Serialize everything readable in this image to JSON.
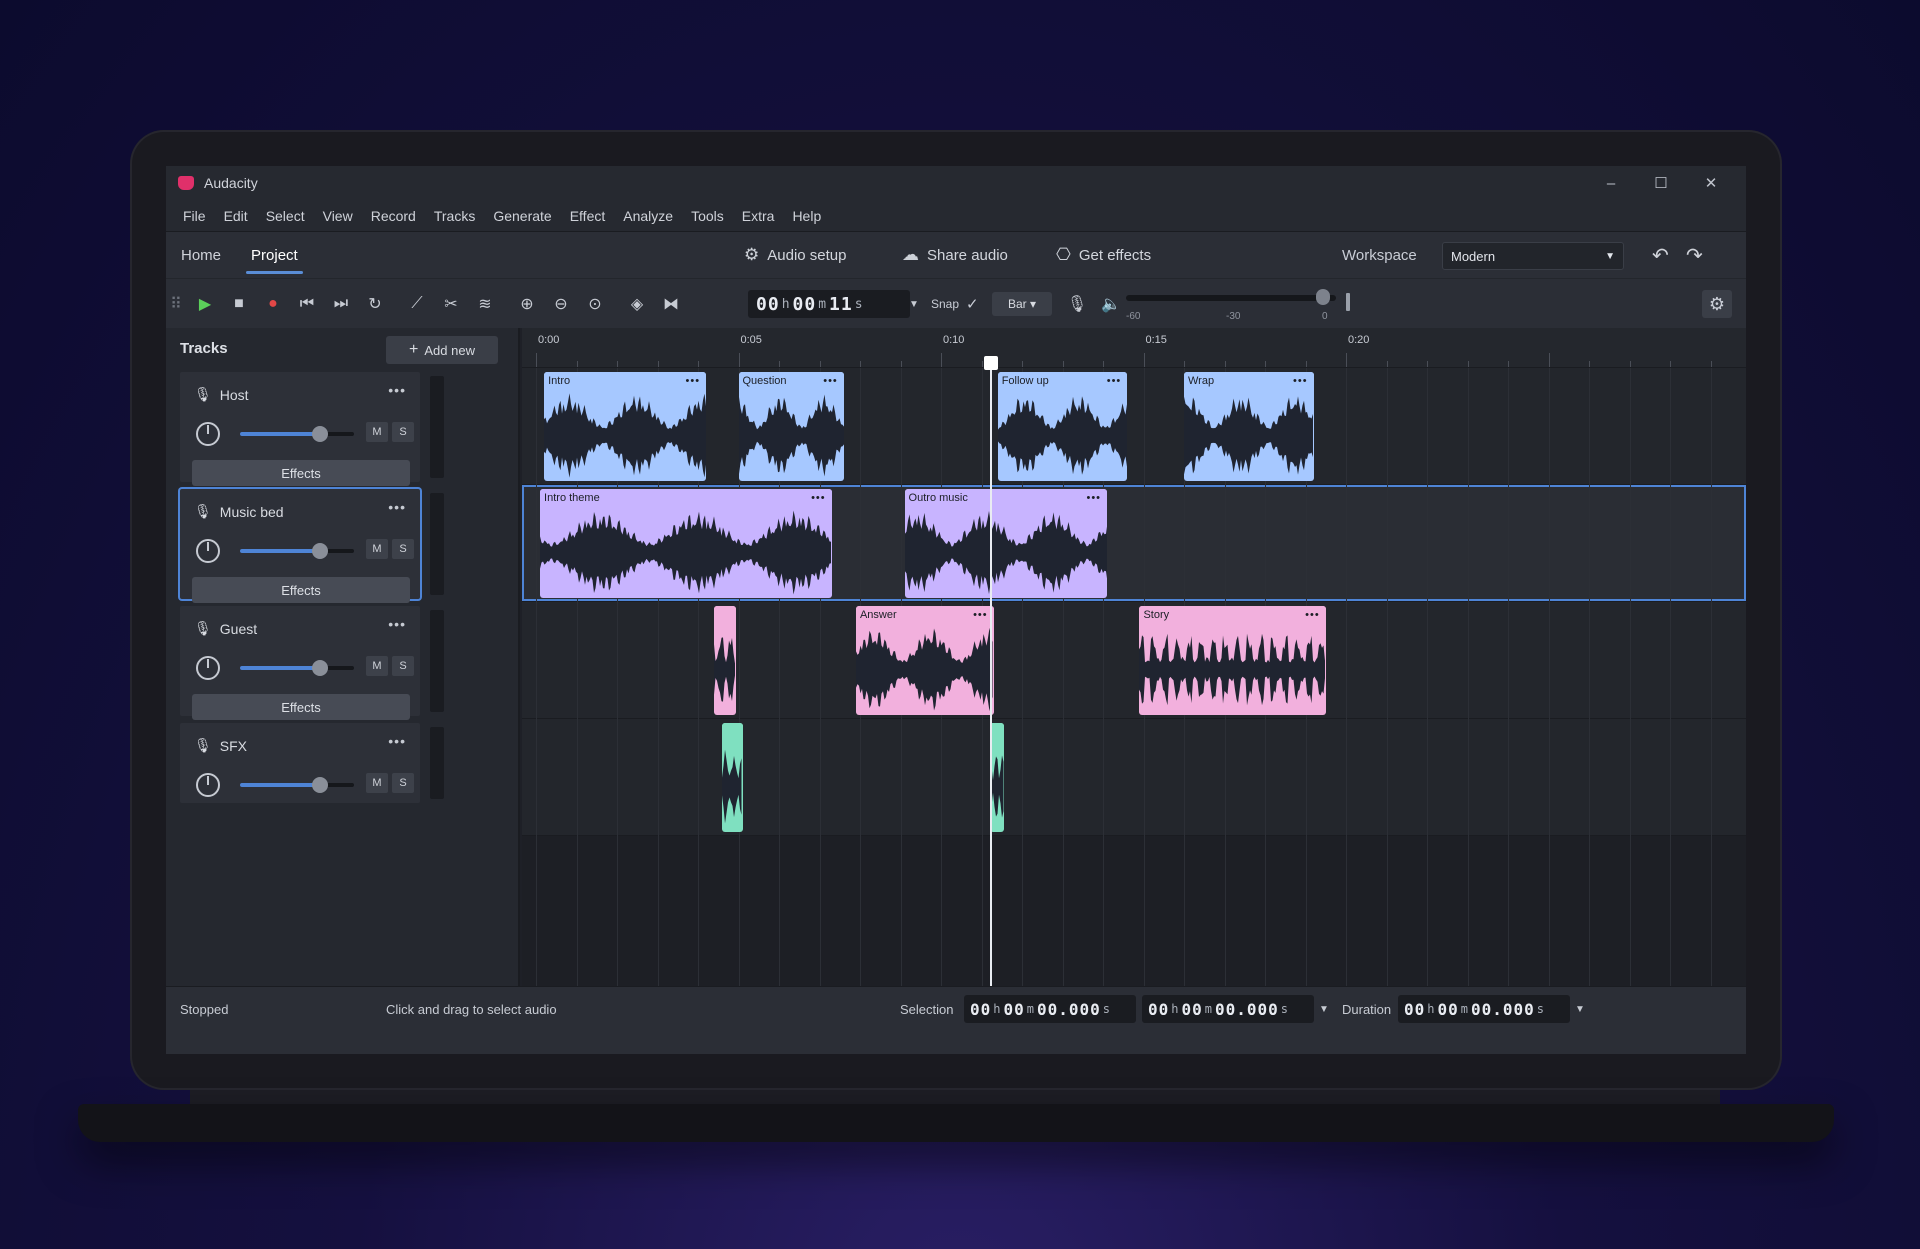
{
  "app": {
    "title": "Audacity"
  },
  "window_controls": {
    "minimize": "–",
    "maximize": "☐",
    "close": "✕"
  },
  "menu": [
    "File",
    "Edit",
    "Select",
    "View",
    "Record",
    "Tracks",
    "Generate",
    "Effect",
    "Analyze",
    "Tools",
    "Extra",
    "Help"
  ],
  "ribbon": {
    "tabs": [
      {
        "label": "Home",
        "active": false
      },
      {
        "label": "Project",
        "active": true
      }
    ],
    "audio_setup": "Audio setup",
    "share_audio": "Share audio",
    "get_effects": "Get effects",
    "workspace_label": "Workspace",
    "workspace_value": "Modern"
  },
  "toolbar": {
    "timecode": {
      "hh": "00",
      "mm": "00",
      "ss": "11",
      "h": "h",
      "m": "m",
      "s": "s"
    },
    "snap_label": "Snap",
    "snap_unit": "Bar",
    "meter_ticks": [
      "-60",
      "-30",
      "0"
    ]
  },
  "tracks_panel": {
    "title": "Tracks",
    "add_new": "Add new",
    "tracks": [
      {
        "name": "Host",
        "effects": "Effects",
        "mute": "M",
        "solo": "S",
        "volume": 0.7,
        "selected": false,
        "has_effects": true
      },
      {
        "name": "Music bed",
        "effects": "Effects",
        "mute": "M",
        "solo": "S",
        "volume": 0.7,
        "selected": true,
        "has_effects": true
      },
      {
        "name": "Guest",
        "effects": "Effects",
        "mute": "M",
        "solo": "S",
        "volume": 0.7,
        "selected": false,
        "has_effects": true
      },
      {
        "name": "SFX",
        "effects": "",
        "mute": "M",
        "solo": "S",
        "volume": 0.7,
        "selected": false,
        "has_effects": false
      }
    ]
  },
  "ruler": {
    "labels": [
      "0:00",
      "0:05",
      "0:10",
      "0:15",
      "0:20"
    ]
  },
  "clips": [
    {
      "track": 0,
      "name": "Intro",
      "start": 0.2,
      "end": 4.2,
      "color": "#a6c8ff"
    },
    {
      "track": 0,
      "name": "Question",
      "start": 5.0,
      "end": 7.6,
      "color": "#a6c8ff"
    },
    {
      "track": 0,
      "name": "Follow up",
      "start": 11.4,
      "end": 14.6,
      "color": "#a6c8ff"
    },
    {
      "track": 0,
      "name": "Wrap",
      "start": 16.0,
      "end": 19.2,
      "color": "#a6c8ff"
    },
    {
      "track": 1,
      "name": "Intro theme",
      "start": 0.1,
      "end": 7.3,
      "color": "#c8b4ff"
    },
    {
      "track": 1,
      "name": "Outro music",
      "start": 9.1,
      "end": 14.1,
      "color": "#c8b4ff"
    },
    {
      "track": 2,
      "name": "",
      "start": 4.4,
      "end": 4.95,
      "color": "#f2b0dd"
    },
    {
      "track": 2,
      "name": "Answer",
      "start": 7.9,
      "end": 11.3,
      "color": "#f2b0dd"
    },
    {
      "track": 2,
      "name": "Story",
      "start": 14.9,
      "end": 19.5,
      "color": "#f2b0dd"
    },
    {
      "track": 3,
      "name": "",
      "start": 4.6,
      "end": 5.1,
      "color": "#7fe0c0"
    },
    {
      "track": 3,
      "name": "",
      "start": 11.2,
      "end": 11.55,
      "color": "#7fe0c0"
    }
  ],
  "playhead_seconds": 11.2,
  "status": {
    "state": "Stopped",
    "hint": "Click and drag to select audio",
    "selection_label": "Selection",
    "duration_label": "Duration",
    "selection_start": {
      "hh": "00",
      "mm": "00",
      "ss": "00.000"
    },
    "selection_end": {
      "hh": "00",
      "mm": "00",
      "ss": "00.000"
    },
    "duration": {
      "hh": "00",
      "mm": "00",
      "ss": "00.000"
    }
  }
}
